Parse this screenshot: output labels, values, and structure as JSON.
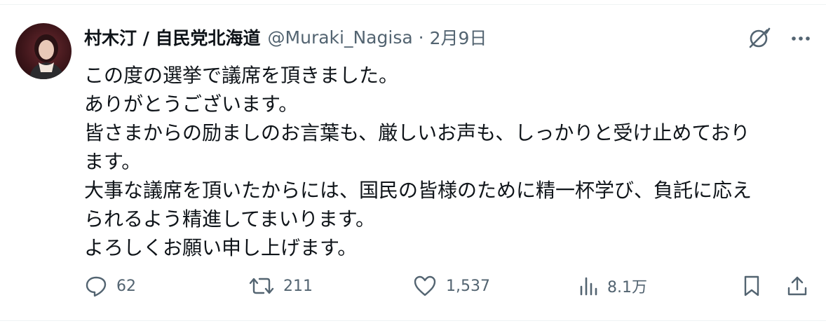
{
  "tweet": {
    "author_name": "村木汀 / 自民党北海道",
    "handle": "@Muraki_Nagisa",
    "separator": "·",
    "date": "2月9日",
    "lines": [
      "この度の選挙で議席を頂きました。",
      "ありがとうございます。",
      "皆さまからの励ましのお言葉も、厳しいお声も、しっかりと受け止めており",
      "ます。",
      "大事な議席を頂いたからには、国民の皆様のために精一杯学び、負託に応え",
      "られるよう精進してまいります。",
      "よろしくお願い申し上げます。"
    ],
    "stats": {
      "replies": "62",
      "retweets": "211",
      "likes": "1,537",
      "views": "8.1万"
    }
  },
  "icons": {
    "grok": "grok-icon",
    "more": "more-icon",
    "reply": "reply-icon",
    "retweet": "retweet-icon",
    "like": "heart-icon",
    "views": "views-icon",
    "bookmark": "bookmark-icon",
    "share": "share-icon"
  },
  "colors": {
    "text": "#0f1419",
    "muted": "#536471",
    "divider": "#eff3f4"
  }
}
